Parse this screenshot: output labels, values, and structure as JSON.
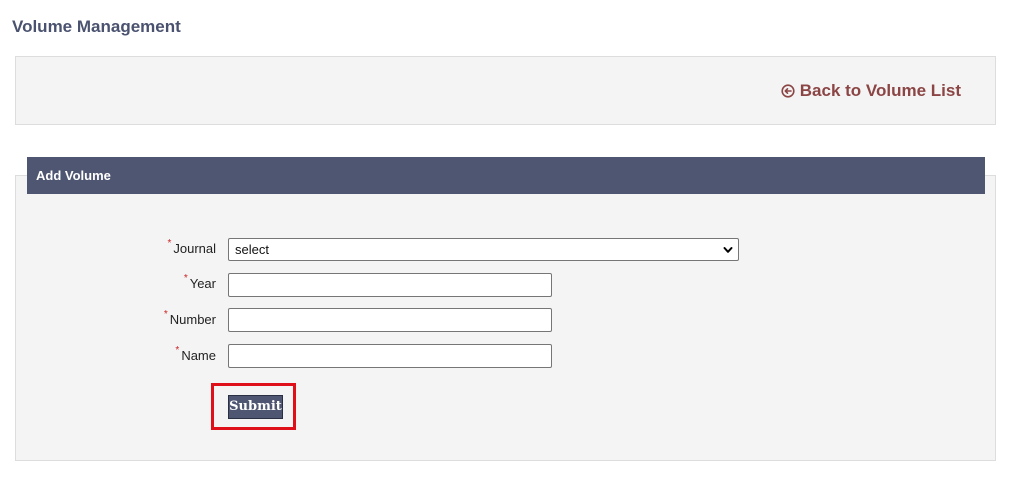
{
  "page": {
    "title": "Volume Management"
  },
  "top_panel": {
    "back_link_label": "Back to Volume List",
    "back_icon": "circle-arrow-left-icon"
  },
  "form": {
    "header": "Add Volume",
    "required_marker": "*",
    "fields": {
      "journal": {
        "label": "Journal",
        "selected": "select"
      },
      "year": {
        "label": "Year",
        "value": ""
      },
      "number": {
        "label": "Number",
        "value": ""
      },
      "name": {
        "label": "Name",
        "value": ""
      }
    },
    "submit_label": "Submit"
  },
  "colors": {
    "header_bg": "#4f5672",
    "link": "#8b4545",
    "required": "#cc2222",
    "highlight": "#e0101a"
  }
}
